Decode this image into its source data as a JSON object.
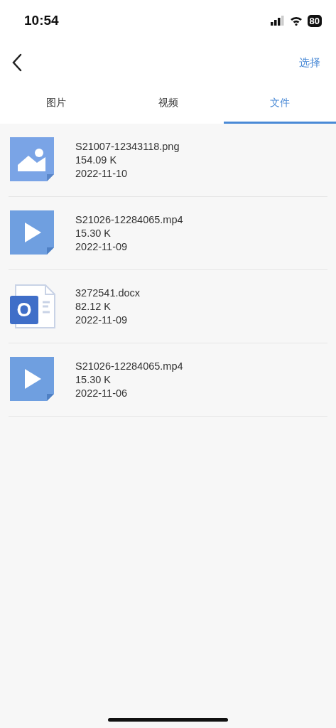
{
  "status_bar": {
    "time": "10:54",
    "battery": "80"
  },
  "nav": {
    "action": "选择"
  },
  "tabs": [
    {
      "label": "图片",
      "selected": false
    },
    {
      "label": "视频",
      "selected": false
    },
    {
      "label": "文件",
      "selected": true
    }
  ],
  "files": [
    {
      "kind": "image",
      "name": "S21007-12343118.png",
      "size": "154.09 K",
      "date": "2022-11-10"
    },
    {
      "kind": "video",
      "name": "S21026-12284065.mp4",
      "size": "15.30 K",
      "date": "2022-11-09"
    },
    {
      "kind": "document",
      "icon_letter": "O",
      "name": "3272541.docx",
      "size": "82.12 K",
      "date": "2022-11-09"
    },
    {
      "kind": "video",
      "name": "S21026-12284065.mp4",
      "size": "15.30 K",
      "date": "2022-11-06"
    }
  ]
}
